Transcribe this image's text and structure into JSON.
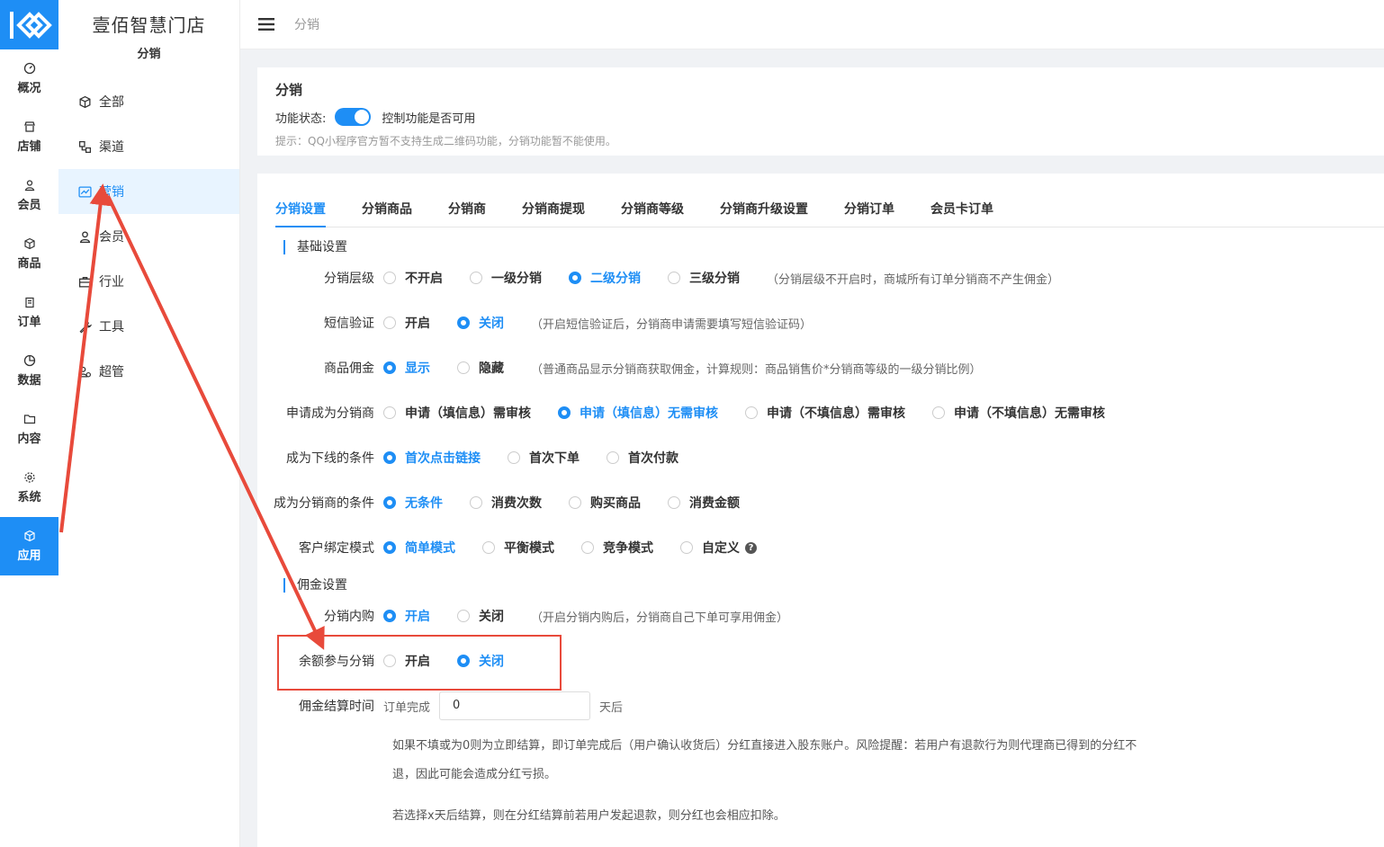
{
  "rail": [
    {
      "label": "概况",
      "icon": "dashboard-icon"
    },
    {
      "label": "店铺",
      "icon": "store-icon"
    },
    {
      "label": "会员",
      "icon": "user-icon"
    },
    {
      "label": "商品",
      "icon": "box-icon"
    },
    {
      "label": "订单",
      "icon": "clipboard-icon"
    },
    {
      "label": "数据",
      "icon": "pie-chart-icon"
    },
    {
      "label": "内容",
      "icon": "folder-icon"
    },
    {
      "label": "系统",
      "icon": "gear-icon"
    },
    {
      "label": "应用",
      "icon": "cube-icon",
      "active": true
    }
  ],
  "subnav": {
    "shop_name": "壹佰智慧门店",
    "subtitle": "分销",
    "items": [
      {
        "label": "全部",
        "icon": "cube-icon"
      },
      {
        "label": "渠道",
        "icon": "channel-icon"
      },
      {
        "label": "营销",
        "icon": "trend-icon",
        "active": true
      },
      {
        "label": "会员",
        "icon": "user-icon"
      },
      {
        "label": "行业",
        "icon": "briefcase-icon"
      },
      {
        "label": "工具",
        "icon": "wrench-icon"
      },
      {
        "label": "超管",
        "icon": "admin-icon"
      }
    ]
  },
  "topbar": {
    "breadcrumb": "分销"
  },
  "panel1": {
    "title": "分销",
    "status_label": "功能状态:",
    "status_on": true,
    "status_desc": "控制功能是否可用",
    "hint": "提示：QQ小程序官方暂不支持生成二维码功能，分销功能暂不能使用。"
  },
  "tabs": [
    "分销设置",
    "分销商品",
    "分销商",
    "分销商提现",
    "分销商等级",
    "分销商升级设置",
    "分销订单",
    "会员卡订单"
  ],
  "sections": {
    "basic": "基础设置",
    "commission": "佣金设置"
  },
  "settings": {
    "level": {
      "label": "分销层级",
      "options": [
        "不开启",
        "一级分销",
        "二级分销",
        "三级分销"
      ],
      "selected": 2,
      "note": "（分销层级不开启时，商城所有订单分销商不产生佣金）"
    },
    "sms": {
      "label": "短信验证",
      "options": [
        "开启",
        "关闭"
      ],
      "selected": 1,
      "note": "（开启短信验证后，分销商申请需要填写短信验证码）"
    },
    "commission_show": {
      "label": "商品佣金",
      "options": [
        "显示",
        "隐藏"
      ],
      "selected": 0,
      "note": "（普通商品显示分销商获取佣金，计算规则：商品销售价*分销商等级的一级分销比例）"
    },
    "apply": {
      "label": "申请成为分销商",
      "options": [
        "申请（填信息）需审核",
        "申请（填信息）无需审核",
        "申请（不填信息）需审核",
        "申请（不填信息）无需审核"
      ],
      "selected": 1,
      "note": ""
    },
    "downline": {
      "label": "成为下线的条件",
      "options": [
        "首次点击链接",
        "首次下单",
        "首次付款"
      ],
      "selected": 0,
      "note": ""
    },
    "become": {
      "label": "成为分销商的条件",
      "options": [
        "无条件",
        "消费次数",
        "购买商品",
        "消费金额"
      ],
      "selected": 0,
      "note": ""
    },
    "bind": {
      "label": "客户绑定模式",
      "options": [
        "简单模式",
        "平衡模式",
        "竞争模式",
        "自定义"
      ],
      "selected": 0,
      "note": ""
    },
    "internal": {
      "label": "分销内购",
      "options": [
        "开启",
        "关闭"
      ],
      "selected": 0,
      "note": "（开启分销内购后，分销商自己下单可享用佣金）"
    },
    "balance": {
      "label": "余额参与分销",
      "options": [
        "开启",
        "关闭"
      ],
      "selected": 1,
      "note": ""
    }
  },
  "settle": {
    "label": "佣金结算时间",
    "prefix": "订单完成",
    "value": "0",
    "suffix": "天后",
    "desc1": "如果不填或为0则为立即结算，即订单完成后（用户确认收货后）分红直接进入股东账户。风险提醒：若用户有退款行为则代理商已得到的分红不退，因此可能会造成分红亏损。",
    "desc2": "若选择x天后结算，则在分红结算前若用户发起退款，则分红也会相应扣除。"
  },
  "colors": {
    "accent": "#1e8ef5",
    "annotation": "#e84a3b"
  }
}
